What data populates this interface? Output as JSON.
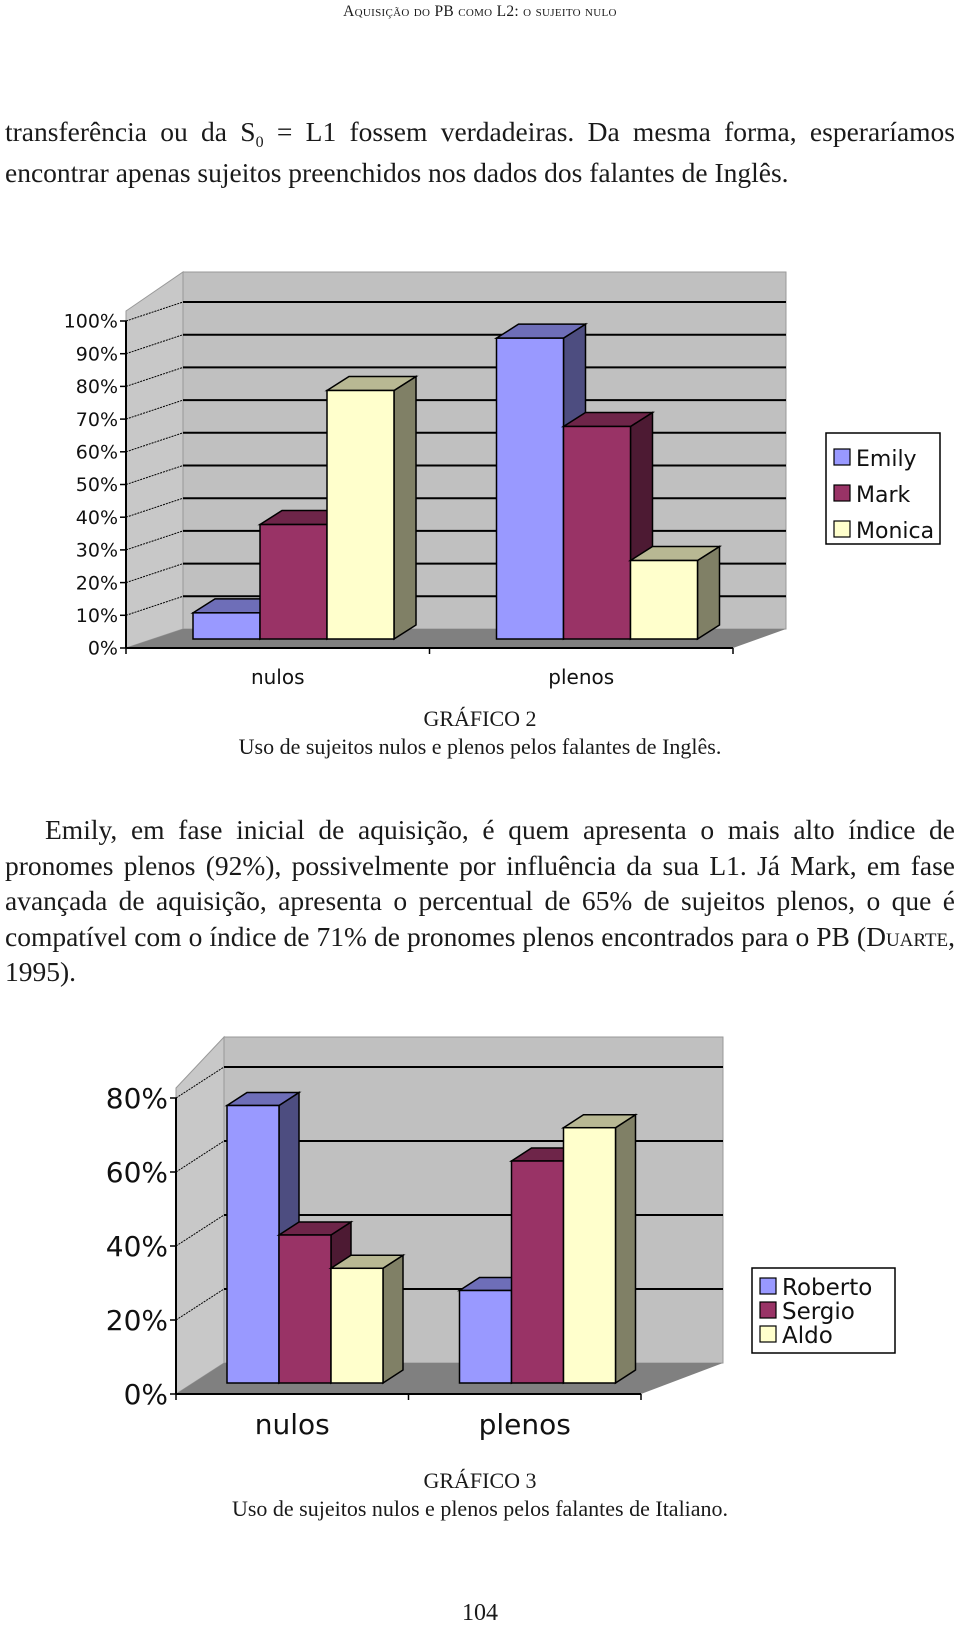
{
  "page": {
    "running_head": "Aquisição do PB como L2: o sujeito nulo",
    "page_number": "104",
    "paragraph1": {
      "part1": "transferência ou da S",
      "subscript": "0",
      "part2": " = L1 fossem verdadeiras. Da mesma forma, esperaríamos encontrar apenas sujeitos preenchidos nos dados dos falantes de Inglês."
    },
    "paragraph2": {
      "part1": "Emily, em fase inicial de aquisição, é quem apresenta o mais alto índice de pronomes plenos (92%), possivelmente por influência da sua L1. Já Mark, em fase avançada de aquisição, apresenta o percentual de 65% de sujeitos plenos, o que é compatível com o índice de 71% de pronomes plenos encontrados para o PB (",
      "smallcaps": "Duarte",
      "part2": ", 1995)."
    },
    "figure2": {
      "label": "GRÁFICO 2",
      "caption": "Uso de sujeitos nulos e plenos pelos falantes de Inglês."
    },
    "figure3": {
      "label": "GRÁFICO 3",
      "caption": "Uso de sujeitos nulos e plenos pelos falantes de Italiano."
    }
  },
  "colors": {
    "series1": "#9999ff",
    "series2": "#993366",
    "series3": "#ffffcc",
    "wall": "#c0c0c0",
    "floor": "#808080"
  },
  "chart_data": [
    {
      "id": "grafico-2",
      "type": "bar",
      "style": "3d-clustered-column",
      "title": "",
      "xlabel": "",
      "ylabel": "",
      "categories": [
        "nulos",
        "plenos"
      ],
      "series": [
        {
          "name": "Emily",
          "values": [
            8,
            92
          ]
        },
        {
          "name": "Mark",
          "values": [
            35,
            65
          ]
        },
        {
          "name": "Monica",
          "values": [
            76,
            24
          ]
        }
      ],
      "ylim": [
        0,
        100
      ],
      "yticks": [
        0,
        10,
        20,
        30,
        40,
        50,
        60,
        70,
        80,
        90,
        100
      ],
      "ytick_labels": [
        "0%",
        "10%",
        "20%",
        "30%",
        "40%",
        "50%",
        "60%",
        "70%",
        "80%",
        "90%",
        "100%"
      ],
      "grid": true,
      "legend": "right"
    },
    {
      "id": "grafico-3",
      "type": "bar",
      "style": "3d-clustered-column",
      "title": "",
      "xlabel": "",
      "ylabel": "",
      "categories": [
        "nulos",
        "plenos"
      ],
      "series": [
        {
          "name": "Roberto",
          "values": [
            75,
            25
          ]
        },
        {
          "name": "Sergio",
          "values": [
            40,
            60
          ]
        },
        {
          "name": "Aldo",
          "values": [
            31,
            69
          ]
        }
      ],
      "ylim": [
        0,
        80
      ],
      "yticks": [
        0,
        20,
        40,
        60,
        80
      ],
      "ytick_labels": [
        "0%",
        "20%",
        "40%",
        "60%",
        "80%"
      ],
      "grid": true,
      "legend": "right"
    }
  ]
}
